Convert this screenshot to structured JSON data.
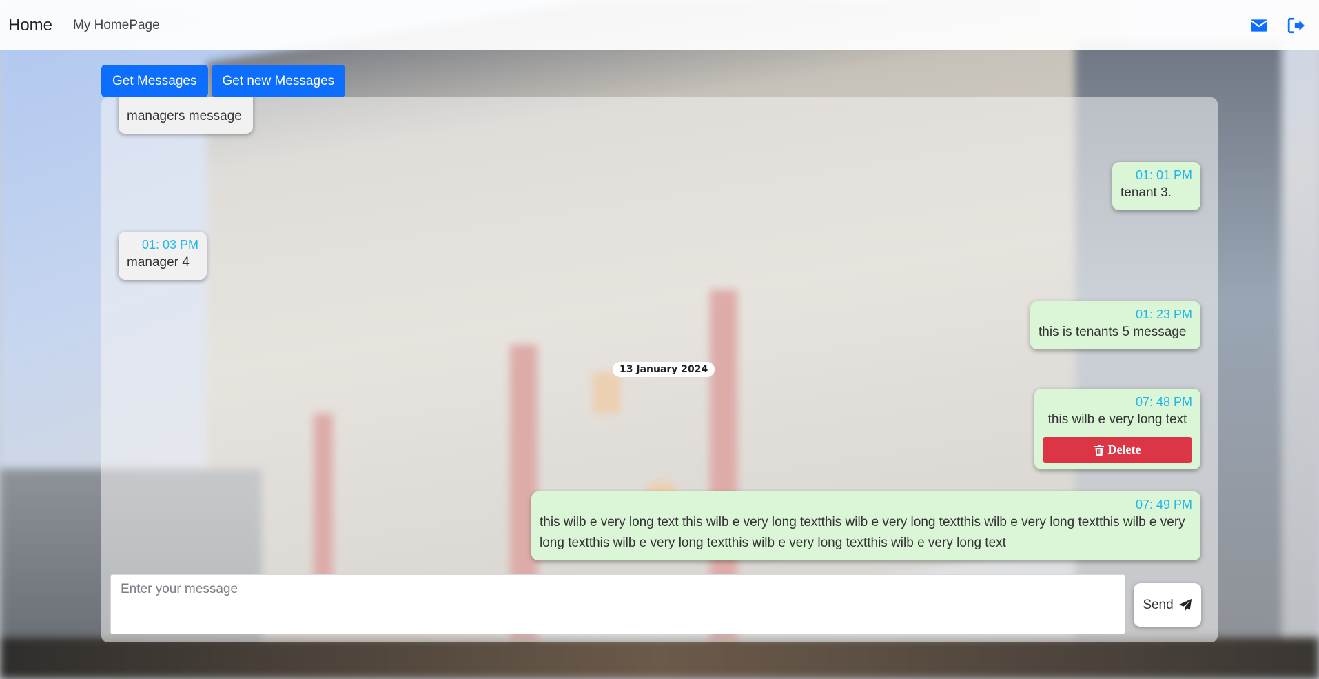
{
  "navbar": {
    "brand": "Home",
    "link": "My HomePage",
    "icons": [
      "envelope-icon",
      "sign-out-icon"
    ],
    "icon_color": "#0d6efd"
  },
  "toolbar": {
    "get_messages_label": "Get Messages",
    "get_new_messages_label": "Get new Messages"
  },
  "chat": {
    "messages": [
      {
        "sender": "manager",
        "time": "",
        "text": "managers message"
      },
      {
        "sender": "tenant",
        "time": "01: 01 PM",
        "text": "tenant 3."
      },
      {
        "sender": "manager",
        "time": "01: 03 PM",
        "text": "manager 4"
      },
      {
        "sender": "tenant",
        "time": "01: 23 PM",
        "text": "this is tenants 5 message"
      },
      {
        "sender": "tenant",
        "time": "07: 48 PM",
        "text": "this wilb e very long text",
        "delete_label": "Delete"
      },
      {
        "sender": "tenant",
        "time": "07: 49 PM",
        "text": "this wilb e very long text this wilb e very long textthis wilb e very long textthis wilb e very long textthis wilb e very long textthis wilb e very long textthis wilb e very long textthis wilb e very long text"
      }
    ],
    "date_separator": "13 January 2024",
    "colors": {
      "manager_bubble": "#f1f1f1",
      "tenant_bubble": "#dbf5d7",
      "timestamp": "#1fb6e8",
      "delete": "#dc3545"
    }
  },
  "composer": {
    "placeholder": "Enter your message",
    "value": "",
    "send_label": "Send",
    "send_icon": "paper-plane-icon"
  }
}
